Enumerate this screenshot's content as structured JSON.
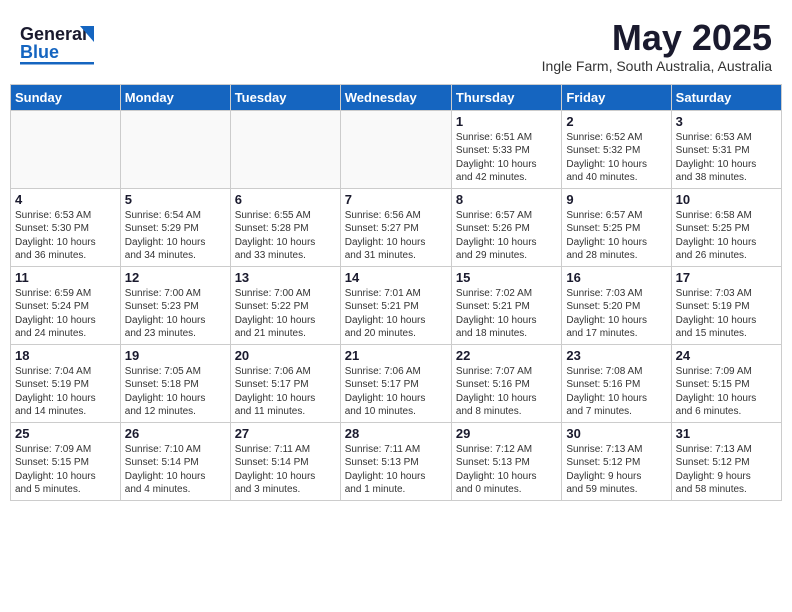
{
  "header": {
    "logo_general": "General",
    "logo_blue": "Blue",
    "month_title": "May 2025",
    "location": "Ingle Farm, South Australia, Australia"
  },
  "days_of_week": [
    "Sunday",
    "Monday",
    "Tuesday",
    "Wednesday",
    "Thursday",
    "Friday",
    "Saturday"
  ],
  "weeks": [
    [
      {
        "day": "",
        "info": ""
      },
      {
        "day": "",
        "info": ""
      },
      {
        "day": "",
        "info": ""
      },
      {
        "day": "",
        "info": ""
      },
      {
        "day": "1",
        "info": "Sunrise: 6:51 AM\nSunset: 5:33 PM\nDaylight: 10 hours\nand 42 minutes."
      },
      {
        "day": "2",
        "info": "Sunrise: 6:52 AM\nSunset: 5:32 PM\nDaylight: 10 hours\nand 40 minutes."
      },
      {
        "day": "3",
        "info": "Sunrise: 6:53 AM\nSunset: 5:31 PM\nDaylight: 10 hours\nand 38 minutes."
      }
    ],
    [
      {
        "day": "4",
        "info": "Sunrise: 6:53 AM\nSunset: 5:30 PM\nDaylight: 10 hours\nand 36 minutes."
      },
      {
        "day": "5",
        "info": "Sunrise: 6:54 AM\nSunset: 5:29 PM\nDaylight: 10 hours\nand 34 minutes."
      },
      {
        "day": "6",
        "info": "Sunrise: 6:55 AM\nSunset: 5:28 PM\nDaylight: 10 hours\nand 33 minutes."
      },
      {
        "day": "7",
        "info": "Sunrise: 6:56 AM\nSunset: 5:27 PM\nDaylight: 10 hours\nand 31 minutes."
      },
      {
        "day": "8",
        "info": "Sunrise: 6:57 AM\nSunset: 5:26 PM\nDaylight: 10 hours\nand 29 minutes."
      },
      {
        "day": "9",
        "info": "Sunrise: 6:57 AM\nSunset: 5:25 PM\nDaylight: 10 hours\nand 28 minutes."
      },
      {
        "day": "10",
        "info": "Sunrise: 6:58 AM\nSunset: 5:25 PM\nDaylight: 10 hours\nand 26 minutes."
      }
    ],
    [
      {
        "day": "11",
        "info": "Sunrise: 6:59 AM\nSunset: 5:24 PM\nDaylight: 10 hours\nand 24 minutes."
      },
      {
        "day": "12",
        "info": "Sunrise: 7:00 AM\nSunset: 5:23 PM\nDaylight: 10 hours\nand 23 minutes."
      },
      {
        "day": "13",
        "info": "Sunrise: 7:00 AM\nSunset: 5:22 PM\nDaylight: 10 hours\nand 21 minutes."
      },
      {
        "day": "14",
        "info": "Sunrise: 7:01 AM\nSunset: 5:21 PM\nDaylight: 10 hours\nand 20 minutes."
      },
      {
        "day": "15",
        "info": "Sunrise: 7:02 AM\nSunset: 5:21 PM\nDaylight: 10 hours\nand 18 minutes."
      },
      {
        "day": "16",
        "info": "Sunrise: 7:03 AM\nSunset: 5:20 PM\nDaylight: 10 hours\nand 17 minutes."
      },
      {
        "day": "17",
        "info": "Sunrise: 7:03 AM\nSunset: 5:19 PM\nDaylight: 10 hours\nand 15 minutes."
      }
    ],
    [
      {
        "day": "18",
        "info": "Sunrise: 7:04 AM\nSunset: 5:19 PM\nDaylight: 10 hours\nand 14 minutes."
      },
      {
        "day": "19",
        "info": "Sunrise: 7:05 AM\nSunset: 5:18 PM\nDaylight: 10 hours\nand 12 minutes."
      },
      {
        "day": "20",
        "info": "Sunrise: 7:06 AM\nSunset: 5:17 PM\nDaylight: 10 hours\nand 11 minutes."
      },
      {
        "day": "21",
        "info": "Sunrise: 7:06 AM\nSunset: 5:17 PM\nDaylight: 10 hours\nand 10 minutes."
      },
      {
        "day": "22",
        "info": "Sunrise: 7:07 AM\nSunset: 5:16 PM\nDaylight: 10 hours\nand 8 minutes."
      },
      {
        "day": "23",
        "info": "Sunrise: 7:08 AM\nSunset: 5:16 PM\nDaylight: 10 hours\nand 7 minutes."
      },
      {
        "day": "24",
        "info": "Sunrise: 7:09 AM\nSunset: 5:15 PM\nDaylight: 10 hours\nand 6 minutes."
      }
    ],
    [
      {
        "day": "25",
        "info": "Sunrise: 7:09 AM\nSunset: 5:15 PM\nDaylight: 10 hours\nand 5 minutes."
      },
      {
        "day": "26",
        "info": "Sunrise: 7:10 AM\nSunset: 5:14 PM\nDaylight: 10 hours\nand 4 minutes."
      },
      {
        "day": "27",
        "info": "Sunrise: 7:11 AM\nSunset: 5:14 PM\nDaylight: 10 hours\nand 3 minutes."
      },
      {
        "day": "28",
        "info": "Sunrise: 7:11 AM\nSunset: 5:13 PM\nDaylight: 10 hours\nand 1 minute."
      },
      {
        "day": "29",
        "info": "Sunrise: 7:12 AM\nSunset: 5:13 PM\nDaylight: 10 hours\nand 0 minutes."
      },
      {
        "day": "30",
        "info": "Sunrise: 7:13 AM\nSunset: 5:12 PM\nDaylight: 9 hours\nand 59 minutes."
      },
      {
        "day": "31",
        "info": "Sunrise: 7:13 AM\nSunset: 5:12 PM\nDaylight: 9 hours\nand 58 minutes."
      }
    ]
  ]
}
